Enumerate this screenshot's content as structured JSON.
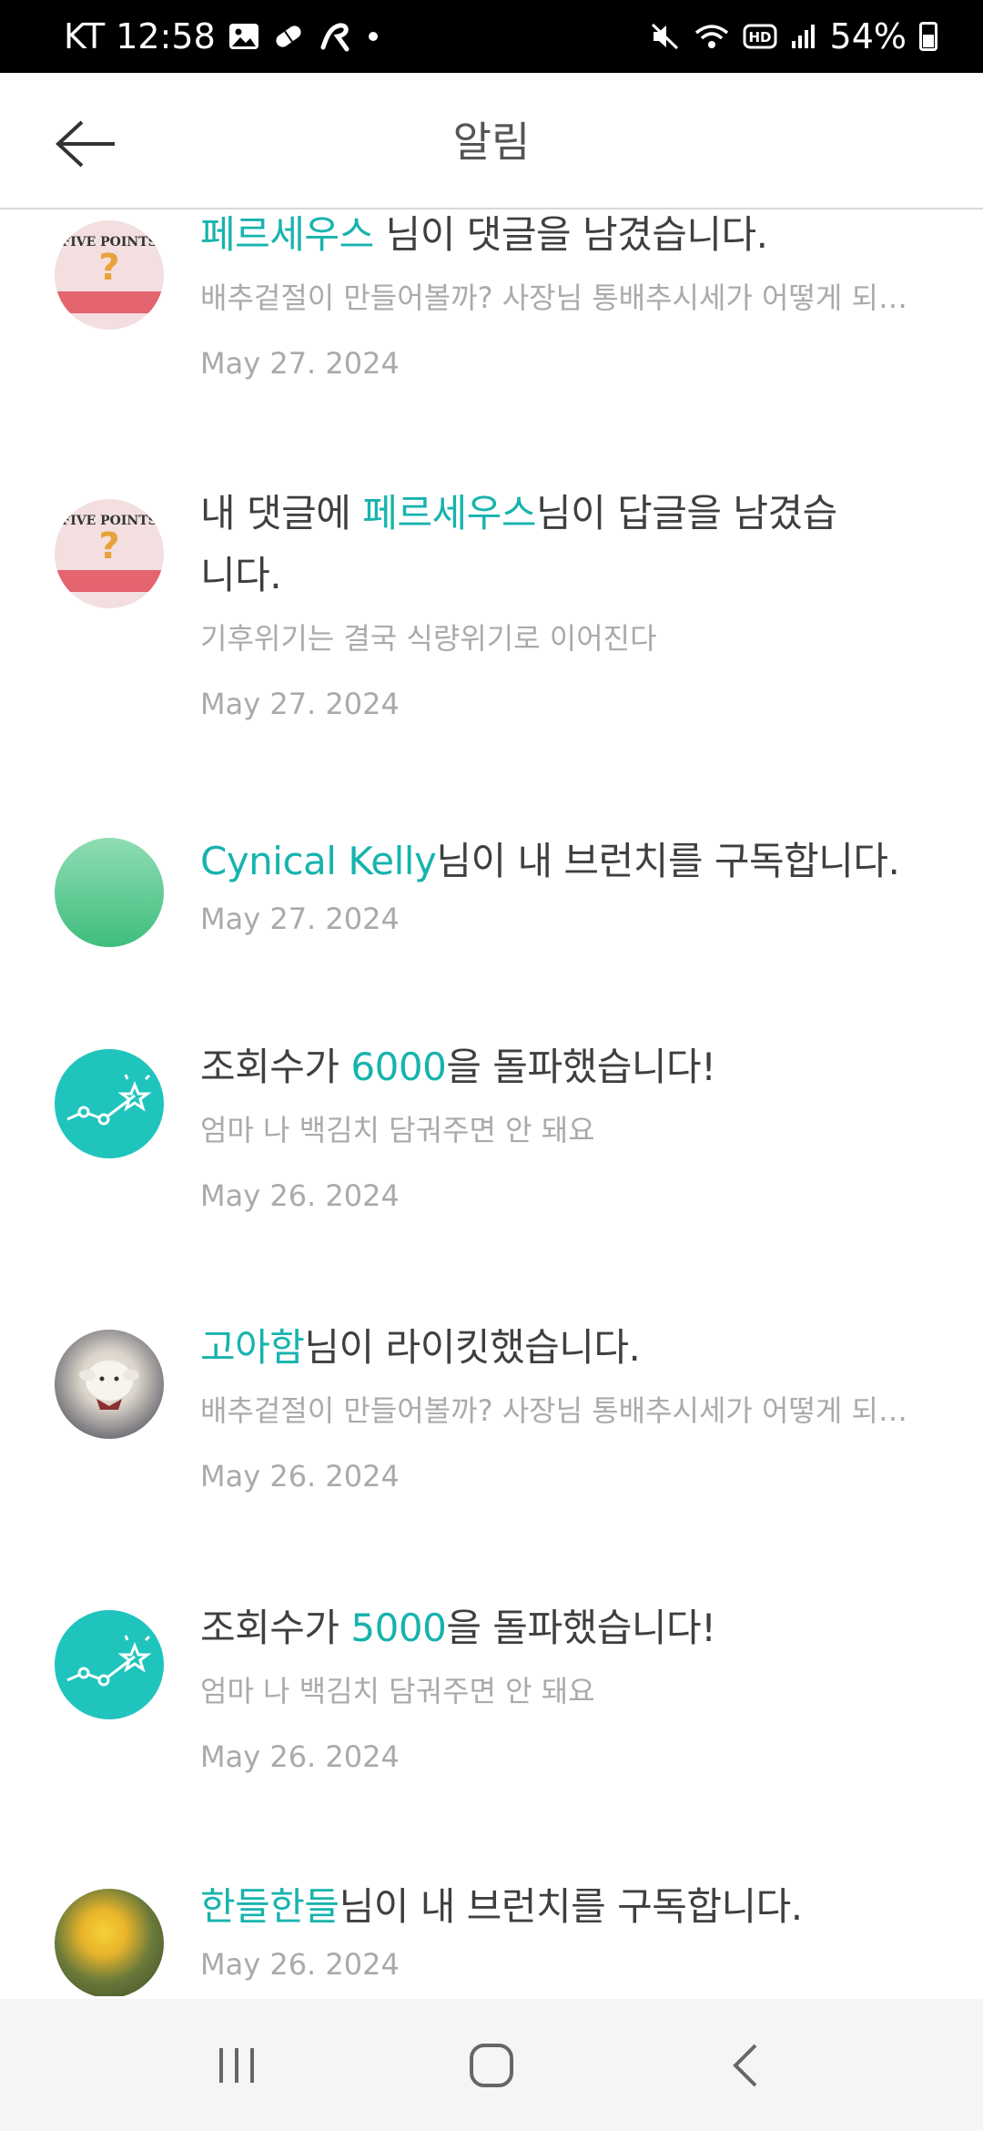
{
  "status_bar": {
    "carrier_time": "KT 12:58",
    "battery": "54%"
  },
  "header": {
    "title": "알림"
  },
  "notifications": [
    {
      "avatar": "book-cover",
      "accent": "페르세우스",
      "text": " 님이 댓글을 남겼습니다.",
      "snippet": "배추겉절이 만들어볼까? 사장님 통배추시세가 어떻게 되나요",
      "date": "May 27. 2024"
    },
    {
      "avatar": "book-cover",
      "prefix": "내 댓글에 ",
      "accent": "페르세우스",
      "text": "님이 답글을 남겼습니다.",
      "snippet": "기후위기는 결국 식량위기로 이어진다",
      "date": "May 27. 2024"
    },
    {
      "avatar": "green-circle",
      "accent": "Cynical Kelly",
      "text": "님이 내 브런치를 구독합니다.",
      "date": "May 27. 2024"
    },
    {
      "avatar": "views-graph-icon",
      "prefix": "조회수가 ",
      "accent": "6000",
      "text": "을 돌파했습니다!",
      "snippet": "엄마 나 백김치 담궈주면 안 돼요",
      "date": "May 26. 2024"
    },
    {
      "avatar": "lamb-photo",
      "accent": "고아함",
      "text": "님이 라이킷했습니다.",
      "snippet": "배추겉절이 만들어볼까? 사장님 통배추시세가 어떻게 되나요",
      "date": "May 26. 2024"
    },
    {
      "avatar": "views-graph-icon",
      "prefix": "조회수가 ",
      "accent": "5000",
      "text": "을 돌파했습니다!",
      "snippet": "엄마 나 백김치 담궈주면 안 돼요",
      "date": "May 26. 2024"
    },
    {
      "avatar": "flower-photo",
      "accent": "한들한들",
      "text": "님이 내 브런치를 구독합니다.",
      "date": "May 26. 2024"
    }
  ],
  "book_cover_title": "FIVE POINTS",
  "colors": {
    "accent": "#17b3ad",
    "teal_icon": "#1fc4bd"
  }
}
